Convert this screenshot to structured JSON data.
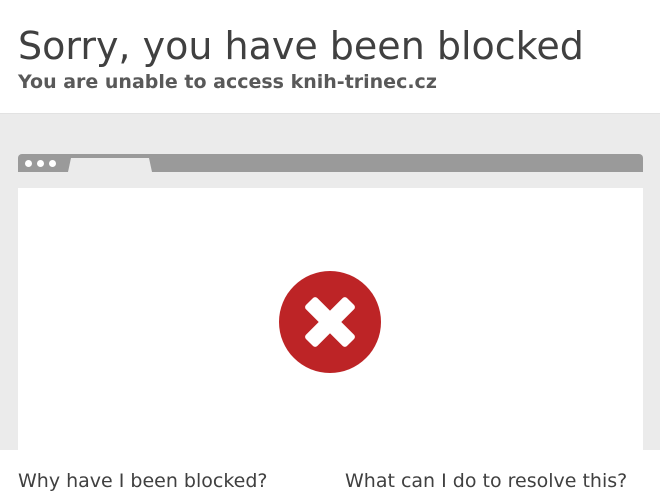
{
  "header": {
    "title": "Sorry, you have been blocked",
    "subtitle": "You are unable to access knih-trinec.cz"
  },
  "illustration": {
    "icon": "blocked-x-icon",
    "colors": {
      "error_red": "#bd2426",
      "frame_gray": "#9a9a9a",
      "band_gray": "#ebebeb"
    }
  },
  "sections": {
    "why_heading": "Why have I been blocked?",
    "resolve_heading": "What can I do to resolve this?"
  }
}
